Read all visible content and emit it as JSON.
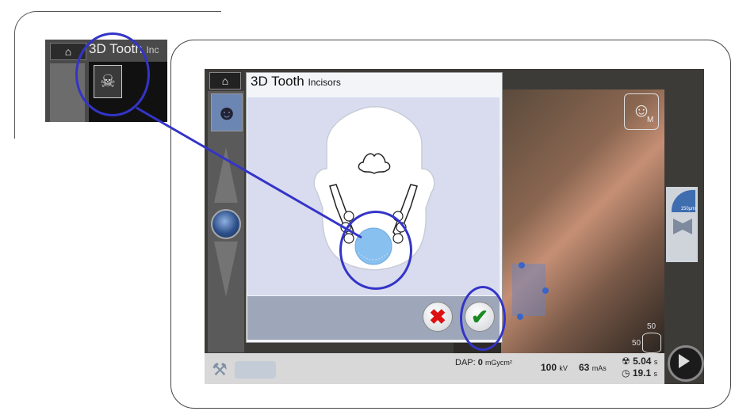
{
  "zoom_inset": {
    "title": "3D Tooth",
    "title_sub": "Inc",
    "home_icon": "home-icon",
    "program_icon": "skull-jaw-icon"
  },
  "screen": {
    "home_icon": "home-icon",
    "thumb_icon": "face-profile-icon",
    "face_mode_icon": "face-front-icon",
    "face_mode_label": "M",
    "resolution_label": "150µm",
    "volume_top": "50",
    "volume_bottom": "50"
  },
  "dialog": {
    "title": "3D Tooth",
    "title_sub": "Incisors",
    "selected_region": "incisors",
    "cancel_icon": "close-icon",
    "confirm_icon": "checkmark-icon"
  },
  "bottom_bar": {
    "dap_label": "DAP:",
    "dap_value": "0",
    "dap_unit": "mGycm²",
    "kv_value": "100",
    "kv_unit": "kV",
    "mas_value": "63",
    "mas_unit": "mAs",
    "exposure_time": "5.04",
    "exposure_unit": "s",
    "scan_time": "19.1",
    "scan_unit": "s"
  },
  "colors": {
    "callout": "#3434c8",
    "selection": "#88c0f0",
    "cancel": "#d11111",
    "confirm": "#1b8a22"
  }
}
